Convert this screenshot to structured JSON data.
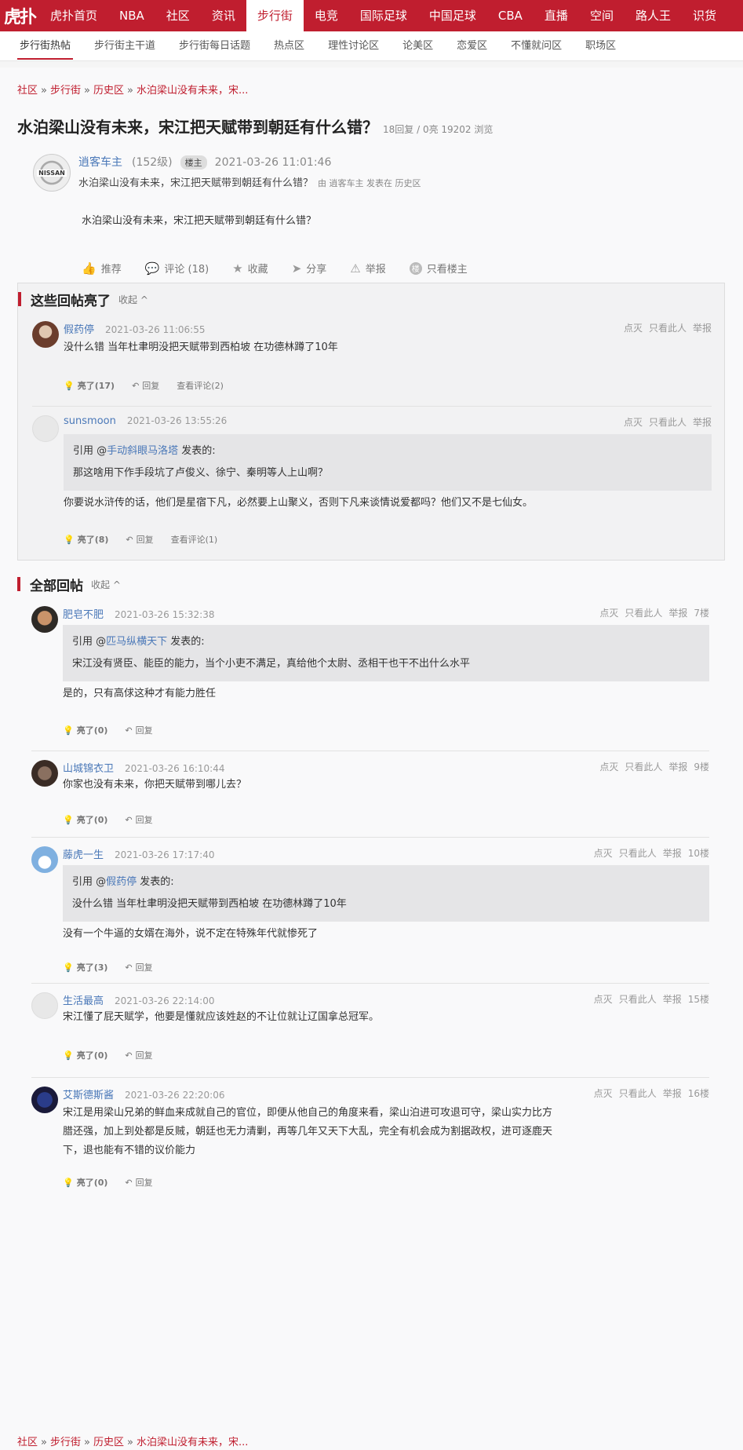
{
  "topnav": {
    "logo": "虎扑",
    "items": [
      "虎扑首页",
      "NBA",
      "社区",
      "资讯",
      "步行街",
      "电竞",
      "国际足球",
      "中国足球",
      "CBA",
      "直播",
      "空间",
      "路人王",
      "识货"
    ],
    "active_index": 4
  },
  "subnav": {
    "items": [
      "步行街热帖",
      "步行街主干道",
      "步行街每日话题",
      "热点区",
      "理性讨论区",
      "论美区",
      "恋爱区",
      "不懂就问区",
      "职场区"
    ],
    "active_index": 0
  },
  "breadcrumb": {
    "items": [
      "社区",
      "步行街",
      "历史区",
      "水泊梁山没有未来，宋..."
    ],
    "sep": "»"
  },
  "thread": {
    "title": "水泊梁山没有未来，宋江把天赋带到朝廷有什么错？",
    "meta": "18回复 / 0亮 19202 浏览"
  },
  "op": {
    "avatar_text": "NISSAN",
    "username": "逍客车主",
    "level": "(152级)",
    "badge": "楼主",
    "time": "2021-03-26 11:01:46",
    "subtitle": "水泊梁山没有未来，宋江把天赋带到朝廷有什么错？",
    "subtitle_meta": "由 逍客车主 发表在 历史区",
    "body": "水泊梁山没有未来，宋江把天赋带到朝廷有什么错？",
    "actions": [
      {
        "icon": "thumb-up-icon",
        "glyph": "👍",
        "label": "推荐"
      },
      {
        "icon": "comment-icon",
        "glyph": "💬",
        "label": "评论 (18)"
      },
      {
        "icon": "star-icon",
        "glyph": "★",
        "label": "收藏"
      },
      {
        "icon": "share-icon",
        "glyph": "➤",
        "label": "分享"
      },
      {
        "icon": "warning-icon",
        "glyph": "⚠",
        "label": "举报"
      },
      {
        "icon": "host-icon",
        "glyph": "楼",
        "label": "只看楼主"
      }
    ]
  },
  "highlight": {
    "title": "这些回帖亮了",
    "collapse": "收起 ^",
    "replies": [
      {
        "username": "假药停",
        "time": "2021-03-26 11:06:55",
        "meta": [
          "点灭",
          "只看此人",
          "举报"
        ],
        "body": "没什么错 当年杜聿明没把天赋带到西柏坡 在功德林蹲了10年",
        "actions": [
          "亮了(17)",
          "回复",
          "查看评论(2)"
        ]
      },
      {
        "username": "sunsmoon",
        "time": "2021-03-26 13:55:26",
        "meta": [
          "点灭",
          "只看此人",
          "举报"
        ],
        "quote_prefix": "引用 @",
        "quote_user": "手动斜眼马洛塔",
        "quote_suffix": " 发表的:",
        "quote_text": "那这啥用下作手段坑了卢俊义、徐宁、秦明等人上山啊？",
        "body": "你要说水浒传的话，他们是星宿下凡，必然要上山聚义，否则下凡来谈情说爱都吗？他们又不是七仙女。",
        "actions": [
          "亮了(8)",
          "回复",
          "查看评论(1)"
        ]
      }
    ]
  },
  "all": {
    "title": "全部回帖",
    "collapse": "收起 ^",
    "replies": [
      {
        "username": "肥皂不肥",
        "time": "2021-03-26 15:32:38",
        "meta": [
          "点灭",
          "只看此人",
          "举报",
          "7楼"
        ],
        "quote_prefix": "引用 @",
        "quote_user": "匹马纵横天下",
        "quote_suffix": " 发表的:",
        "quote_text": "宋江没有贤臣、能臣的能力，当个小吏不满足，真给他个太尉、丞相干也干不出什么水平",
        "body": "是的，只有高俅这种才有能力胜任",
        "actions": [
          "亮了(0)",
          "回复"
        ]
      },
      {
        "username": "山城锦衣卫",
        "time": "2021-03-26 16:10:44",
        "meta": [
          "点灭",
          "只看此人",
          "举报",
          "9楼"
        ],
        "body": "你家也没有未来，你把天赋带到哪儿去？",
        "actions": [
          "亮了(0)",
          "回复"
        ]
      },
      {
        "username": "藤虎一生",
        "time": "2021-03-26 17:17:40",
        "meta": [
          "点灭",
          "只看此人",
          "举报",
          "10楼"
        ],
        "quote_prefix": "引用 @",
        "quote_user": "假药停",
        "quote_suffix": " 发表的:",
        "quote_text": "没什么错 当年杜聿明没把天赋带到西柏坡 在功德林蹲了10年",
        "body": "没有一个牛逼的女婿在海外，说不定在特殊年代就惨死了",
        "actions": [
          "亮了(3)",
          "回复"
        ]
      },
      {
        "username": "生活最高",
        "time": "2021-03-26 22:14:00",
        "meta": [
          "点灭",
          "只看此人",
          "举报",
          "15楼"
        ],
        "body": "宋江懂了屁天赋学，他要是懂就应该姓赵的不让位就让辽国拿总冠军。",
        "actions": [
          "亮了(0)",
          "回复"
        ]
      },
      {
        "username": "艾斯德斯酱",
        "time": "2021-03-26 22:20:06",
        "meta": [
          "点灭",
          "只看此人",
          "举报",
          "16楼"
        ],
        "body_lines": [
          "宋江是用梁山兄弟的鲜血来成就自己的官位，即便从他自己的角度来看，梁山泊进可攻退可守，梁山实力比方",
          "腊还强，加上到处都是反贼，朝廷也无力清剿，再等几年又天下大乱，完全有机会成为割据政权，进可逐鹿天",
          "下，退也能有不错的议价能力"
        ],
        "actions": [
          "亮了(0)",
          "回复"
        ]
      }
    ]
  },
  "colors": {
    "brand_red": "#c01e2f",
    "link_blue": "#4a78b8"
  }
}
